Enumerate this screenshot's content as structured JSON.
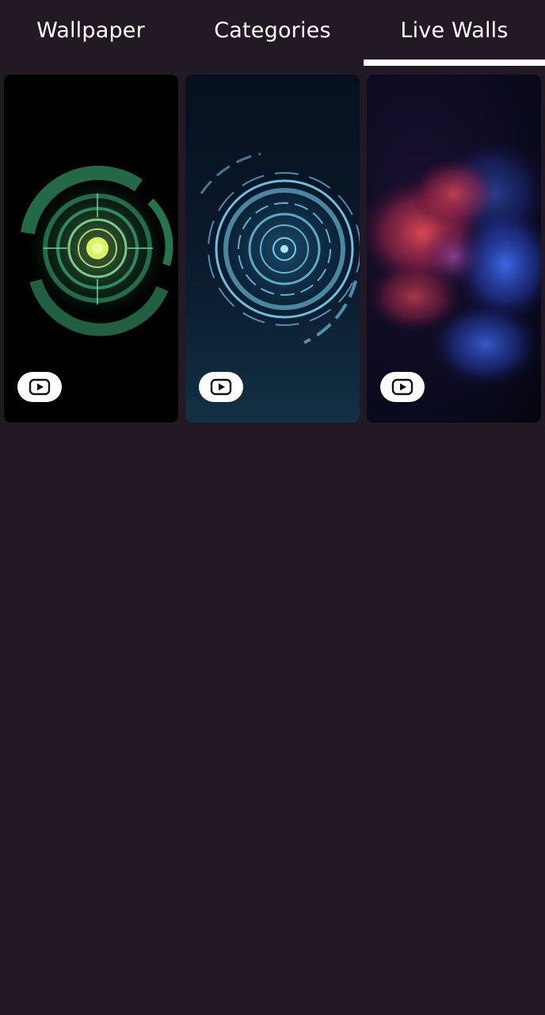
{
  "tabs": [
    {
      "label": "Wallpaper",
      "selected": false
    },
    {
      "label": "Categories",
      "selected": false
    },
    {
      "label": "Live Walls",
      "selected": true
    }
  ],
  "colors": {
    "background": "#231924",
    "tab_text": "#ffffff",
    "indicator": "#ffffff"
  },
  "live_walls": [
    {
      "theme": "green-radial-hud",
      "badge_icon": "video-play-icon"
    },
    {
      "theme": "blue-circular-hud",
      "badge_icon": "video-play-icon"
    },
    {
      "theme": "red-blue-smoke",
      "badge_icon": "video-play-icon"
    }
  ]
}
